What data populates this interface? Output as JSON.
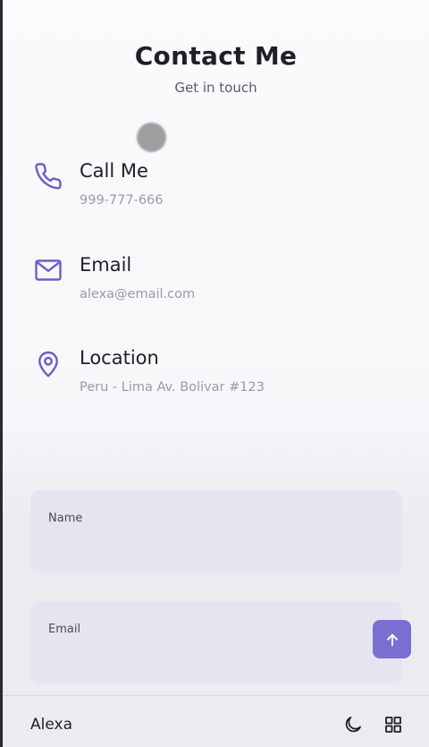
{
  "header": {
    "title": "Contact Me",
    "subtitle": "Get in touch"
  },
  "contact_info": [
    {
      "icon": "phone-icon",
      "label": "Call Me",
      "value": "999-777-666"
    },
    {
      "icon": "mail-icon",
      "label": "Email",
      "value": "alexa@email.com"
    },
    {
      "icon": "location-pin-icon",
      "label": "Location",
      "value": "Peru - Lima Av. Bolivar #123"
    }
  ],
  "form": {
    "name_label": "Name",
    "name_value": "",
    "email_label": "Email",
    "email_value": ""
  },
  "footer": {
    "brand": "Alexa",
    "theme_icon": "moon-icon",
    "menu_icon": "grid-icon"
  },
  "colors": {
    "accent": "#7a6fd0",
    "field_bg": "#e6e4f0",
    "muted_text": "#9a9aa2"
  }
}
